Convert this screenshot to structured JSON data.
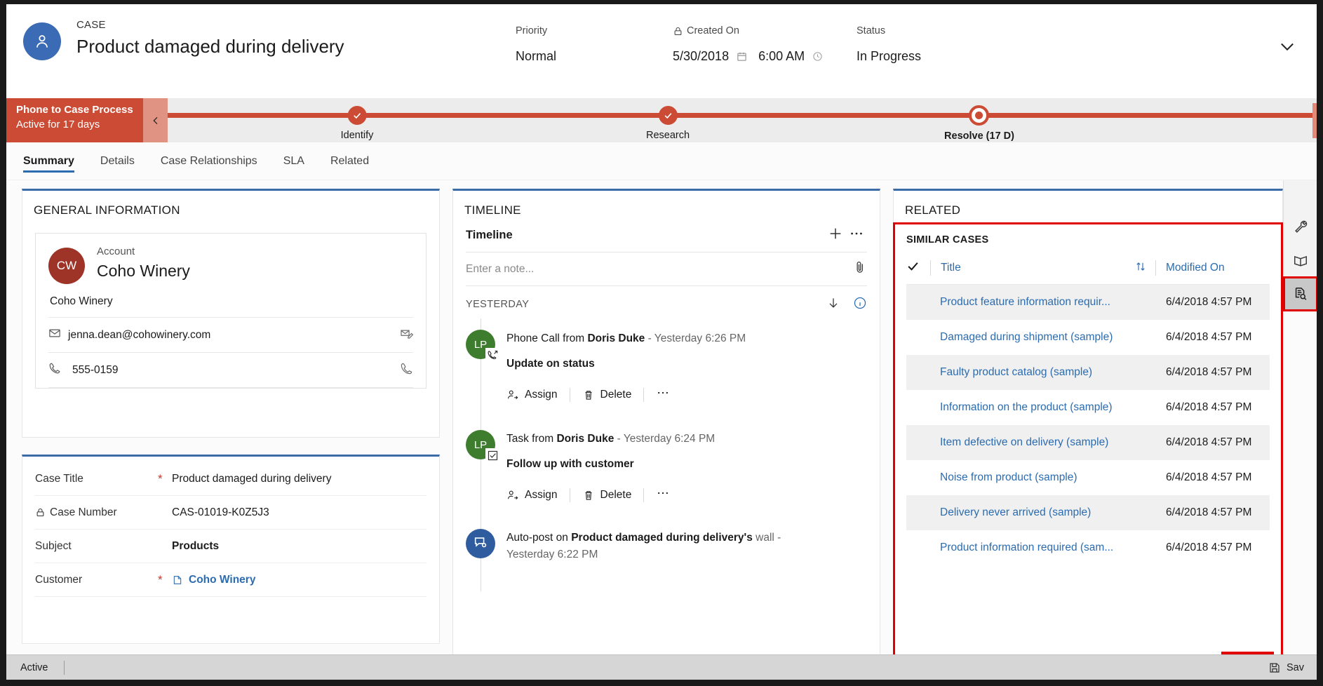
{
  "header": {
    "kicker": "CASE",
    "title": "Product damaged during delivery",
    "fields": [
      {
        "label": "Priority",
        "value": "Normal"
      },
      {
        "label": "Created On",
        "value": "5/30/2018",
        "value2": "6:00 AM"
      },
      {
        "label": "Status",
        "value": "In Progress"
      }
    ],
    "collapse_icon": "chevron-down-icon",
    "lock_icon": "lock-icon",
    "calendar_icon": "calendar-icon",
    "clock_icon": "clock-icon"
  },
  "process_flow": {
    "name": "Phone to Case Process",
    "subtitle": "Active for 17 days",
    "collapse_icon": "chevron-left-icon",
    "stages": [
      {
        "label": "Identify",
        "state": "complete"
      },
      {
        "label": "Research",
        "state": "complete"
      },
      {
        "label": "Resolve  (17 D)",
        "state": "current"
      }
    ]
  },
  "tabs": [
    {
      "label": "Summary",
      "active": true
    },
    {
      "label": "Details",
      "active": false
    },
    {
      "label": "Case Relationships",
      "active": false
    },
    {
      "label": "SLA",
      "active": false
    },
    {
      "label": "Related",
      "active": false
    }
  ],
  "general_information": {
    "heading": "GENERAL INFORMATION",
    "account_label": "Account",
    "account_initials": "CW",
    "account_name": "Coho Winery",
    "account_sub": "Coho Winery",
    "email": "jenna.dean@cohowinery.com",
    "phone": "555-0159",
    "email_icon": "envelope-icon",
    "phone_icon": "phone-icon",
    "email_action_icon": "compose-email-icon",
    "phone_action_icon": "call-icon"
  },
  "case_fields": [
    {
      "label": "Case Title",
      "required": "*",
      "value": "Product damaged during delivery",
      "style": "plain",
      "icon": ""
    },
    {
      "label": "Case Number",
      "required": "",
      "value": "CAS-01019-K0Z5J3",
      "style": "plain",
      "icon": "lock-icon"
    },
    {
      "label": "Subject",
      "required": "",
      "value": "Products",
      "style": "bold",
      "icon": ""
    },
    {
      "label": "Customer",
      "required": "*",
      "value": "Coho Winery",
      "style": "link",
      "icon": "lookup-record-icon"
    }
  ],
  "timeline": {
    "heading": "TIMELINE",
    "subheading": "Timeline",
    "add_icon": "plus-icon",
    "more_icon": "ellipsis-icon",
    "note_placeholder": "Enter a note...",
    "attach_icon": "paperclip-icon",
    "date_group": "YESTERDAY",
    "sort_icon": "arrow-down-icon",
    "info_icon": "info-icon",
    "items": [
      {
        "avatar": "LP",
        "avatar_color": "green",
        "badge_icon": "phone-outgoing-icon",
        "prefix": "Phone Call from ",
        "actor": "Doris Duke",
        "time": " -  Yesterday 6:26 PM",
        "subject": "Update on status",
        "actions": [
          "Assign",
          "Delete"
        ],
        "assign_icon": "assign-user-icon",
        "delete_icon": "trash-icon",
        "more_icon": "ellipsis-icon"
      },
      {
        "avatar": "LP",
        "avatar_color": "green",
        "badge_icon": "task-checkbox-icon",
        "prefix": "Task from ",
        "actor": "Doris Duke",
        "time": "  -  Yesterday 6:24 PM",
        "subject": "Follow up with customer",
        "actions": [
          "Assign",
          "Delete"
        ],
        "assign_icon": "assign-user-icon",
        "delete_icon": "trash-icon",
        "more_icon": "ellipsis-icon"
      },
      {
        "avatar": "",
        "avatar_color": "blue",
        "badge_icon": "auto-post-icon",
        "prefix": "Auto-post on ",
        "actor": "Product damaged during delivery's",
        "time": " wall -  Yesterday 6:22 PM",
        "subject": "",
        "actions": [],
        "assign_icon": "",
        "delete_icon": "",
        "more_icon": ""
      }
    ]
  },
  "related": {
    "heading": "RELATED",
    "similar_cases_title": "SIMILAR CASES",
    "columns": {
      "check_icon": "checkmark-icon",
      "title": "Title",
      "sort_icon": "sort-updown-icon",
      "modified_on": "Modified On"
    },
    "rows": [
      {
        "title": "Product feature information requir...",
        "modified": "6/4/2018 4:57 PM"
      },
      {
        "title": "Damaged during shipment (sample)",
        "modified": "6/4/2018 4:57 PM"
      },
      {
        "title": "Faulty product catalog (sample)",
        "modified": "6/4/2018 4:57 PM"
      },
      {
        "title": "Information on the product (sample)",
        "modified": "6/4/2018 4:57 PM"
      },
      {
        "title": "Item defective on delivery (sample)",
        "modified": "6/4/2018 4:57 PM"
      },
      {
        "title": "Noise from product (sample)",
        "modified": "6/4/2018 4:57 PM"
      },
      {
        "title": "Delivery never arrived (sample)",
        "modified": "6/4/2018 4:57 PM"
      },
      {
        "title": "Product information required (sam...",
        "modified": "6/4/2018 4:57 PM"
      }
    ]
  },
  "rail": [
    {
      "icon": "wrench-icon",
      "selected": false
    },
    {
      "icon": "book-icon",
      "selected": false
    },
    {
      "icon": "document-search-icon",
      "selected": true
    }
  ],
  "footer": {
    "status": "Active",
    "save_label": "Sav",
    "save_icon": "save-disk-icon"
  },
  "colors": {
    "accent_blue": "#2b6cb0",
    "process_red": "#cc4b34",
    "highlight_red": "#e00000",
    "account_avatar": "#9e3328",
    "case_avatar": "#3b6bb5",
    "timeline_green": "#3f7d2e",
    "timeline_blue": "#2f5c9e"
  }
}
